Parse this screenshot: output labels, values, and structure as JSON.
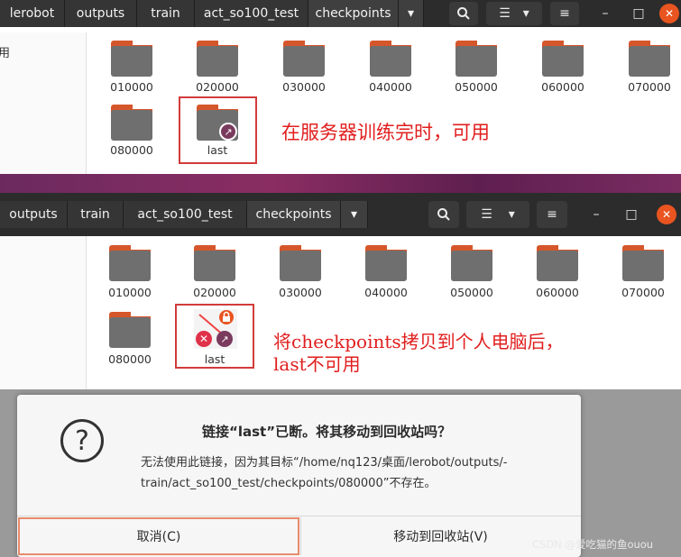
{
  "window1": {
    "breadcrumbs": [
      "lerobot",
      "outputs",
      "train",
      "act_so100_test",
      "checkpoints"
    ],
    "sidebar_partial_text": "用",
    "folders": [
      "010000",
      "020000",
      "030000",
      "040000",
      "050000",
      "060000",
      "070000",
      "080000"
    ],
    "link_folder": "last",
    "annotation": "在服务器训练完时，可用"
  },
  "window2": {
    "breadcrumbs": [
      "outputs",
      "train",
      "act_so100_test",
      "checkpoints"
    ],
    "folders": [
      "010000",
      "020000",
      "030000",
      "040000",
      "050000",
      "060000",
      "070000",
      "080000"
    ],
    "link_folder": "last",
    "annotation_line1": "将checkpoints拷贝到个人电脑后，",
    "annotation_line2": "last不可用"
  },
  "toolbar_icons": [
    "chevron-down-icon",
    "search-icon",
    "list-view-icon",
    "hamburger-menu-icon",
    "minimize-icon",
    "maximize-icon",
    "close-icon"
  ],
  "dialog": {
    "icon": "question-icon",
    "title": "链接“last”已断。将其移动到回收站吗？",
    "message_line1": "无法使用此链接，因为其目标“/home/nq123/桌面/lerobot/outputs/-",
    "message_line2": "train/act_so100_test/checkpoints/080000”不存在。",
    "cancel_label": "取消(C)",
    "trash_label": "移动到回收站(V)"
  },
  "watermark": "CSDN @爱吃猫的鱼ouou",
  "colors": {
    "header": "#2c2c2c",
    "folder_body": "#6f6f6f",
    "folder_tab": "#d6562b",
    "close": "#e95420",
    "annotation": "#e11e1e",
    "accent_strip": "#7a2c61"
  }
}
